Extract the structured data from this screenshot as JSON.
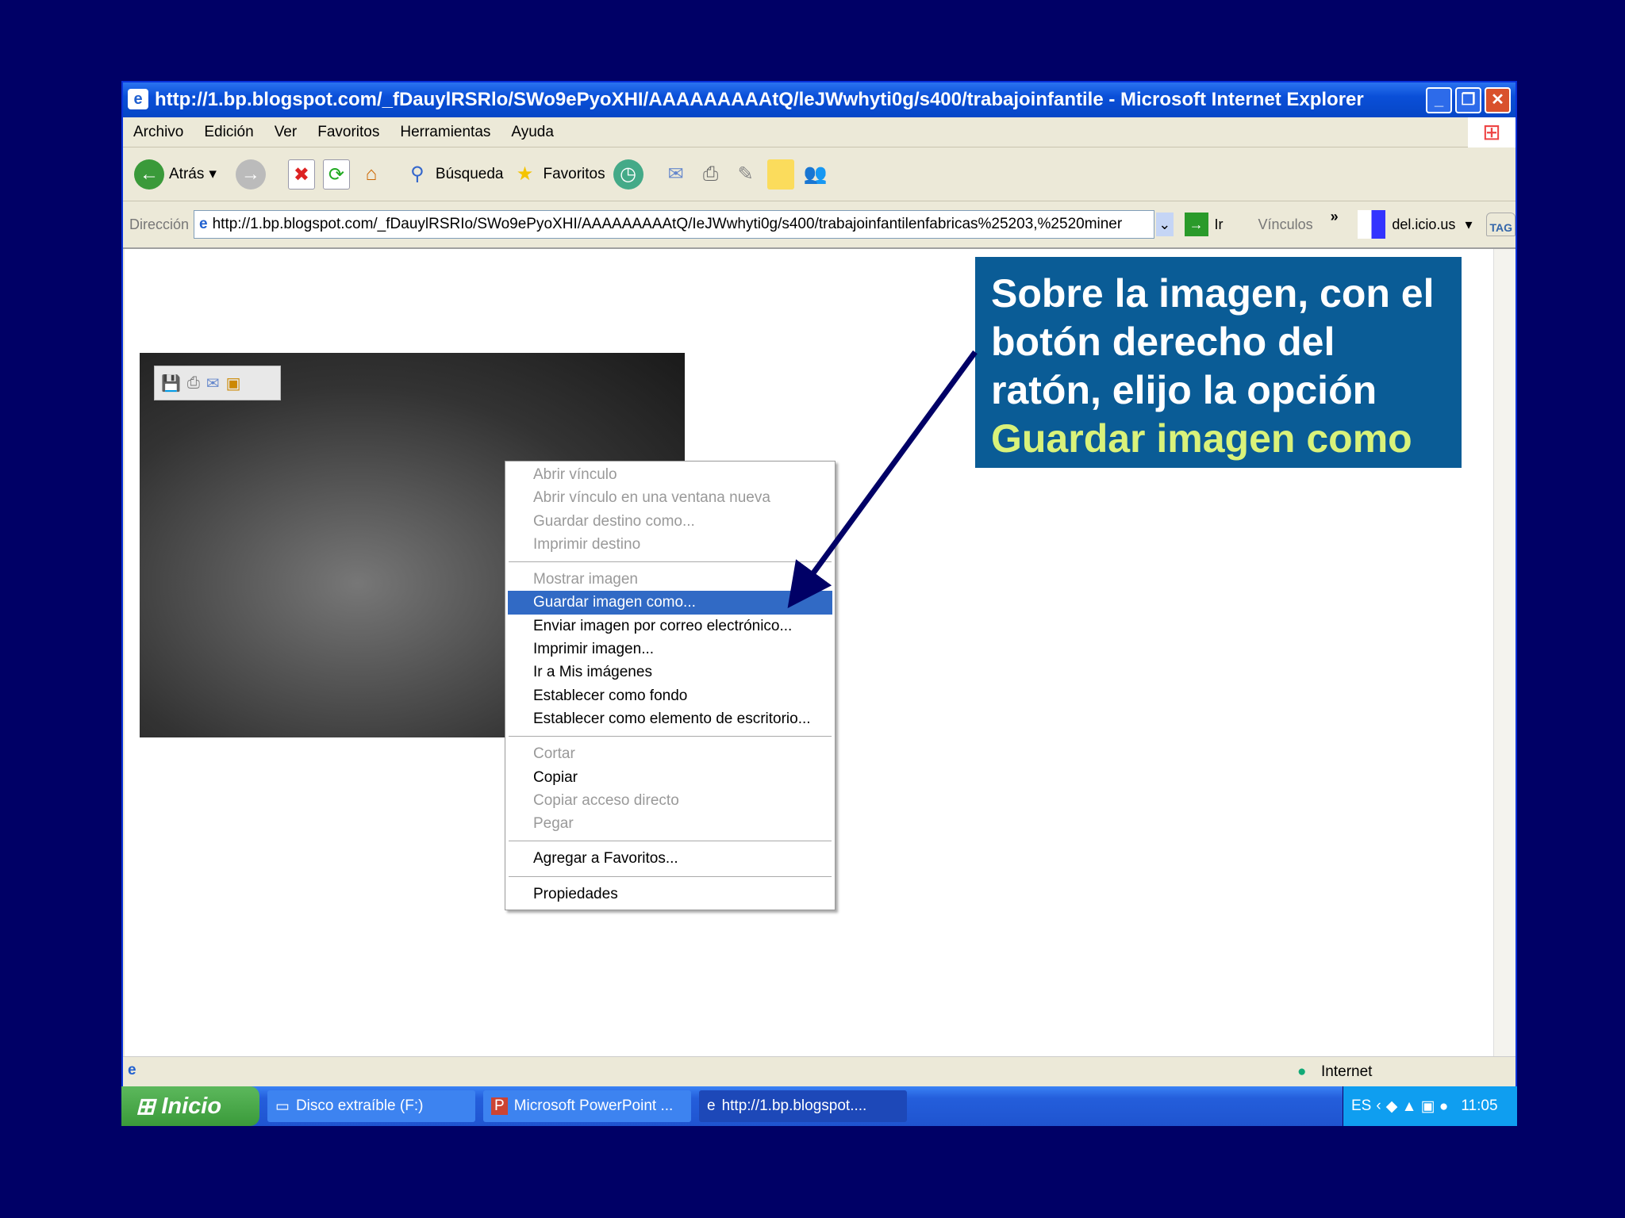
{
  "window": {
    "title": "http://1.bp.blogspot.com/_fDauylRSRlo/SWo9ePyoXHI/AAAAAAAAAtQ/leJWwhyti0g/s400/trabajoinfantile - Microsoft Internet Explorer"
  },
  "menu": [
    "Archivo",
    "Edición",
    "Ver",
    "Favoritos",
    "Herramientas",
    "Ayuda"
  ],
  "toolbar": {
    "back": "Atrás",
    "search": "Búsqueda",
    "favorites": "Favoritos"
  },
  "address": {
    "label": "Dirección",
    "url": "http://1.bp.blogspot.com/_fDauylRSRIo/SWo9ePyoXHI/AAAAAAAAAtQ/IeJWwhyti0g/s400/trabajoinfantilenfabricas%25203,%2520miner",
    "go": "Ir",
    "links": "Vínculos",
    "chevron": "»",
    "delicious": "del.icio.us",
    "tag": "TAG"
  },
  "context_menu": {
    "groups": [
      [
        {
          "label": "Abrir vínculo",
          "enabled": false
        },
        {
          "label": "Abrir vínculo en una ventana nueva",
          "enabled": false
        },
        {
          "label": "Guardar destino como...",
          "enabled": false
        },
        {
          "label": "Imprimir destino",
          "enabled": false
        }
      ],
      [
        {
          "label": "Mostrar imagen",
          "enabled": false
        },
        {
          "label": "Guardar imagen como...",
          "enabled": true,
          "selected": true
        },
        {
          "label": "Enviar imagen por correo electrónico...",
          "enabled": true
        },
        {
          "label": "Imprimir imagen...",
          "enabled": true
        },
        {
          "label": "Ir a Mis imágenes",
          "enabled": true
        },
        {
          "label": "Establecer como fondo",
          "enabled": true
        },
        {
          "label": "Establecer como elemento de escritorio...",
          "enabled": true
        }
      ],
      [
        {
          "label": "Cortar",
          "enabled": false
        },
        {
          "label": "Copiar",
          "enabled": true
        },
        {
          "label": "Copiar acceso directo",
          "enabled": false
        },
        {
          "label": "Pegar",
          "enabled": false
        }
      ],
      [
        {
          "label": "Agregar a Favoritos...",
          "enabled": true
        }
      ],
      [
        {
          "label": "Propiedades",
          "enabled": true
        }
      ]
    ]
  },
  "status": {
    "zone": "Internet"
  },
  "taskbar": {
    "start": "Inicio",
    "tasks": [
      "Disco extraíble (F:)",
      "Microsoft PowerPoint ...",
      "http://1.bp.blogspot...."
    ],
    "lang": "ES",
    "clock": "11:05"
  },
  "callout": {
    "line1": "Sobre la imagen, con el botón derecho del ratón, elijo la opción",
    "highlight": "Guardar imagen como"
  },
  "colors": {
    "selection": "#316ac5",
    "callout_bg": "#0a5c96",
    "highlight": "#d9f27a",
    "background": "#000066"
  }
}
